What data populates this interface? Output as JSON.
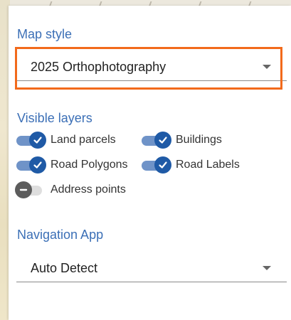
{
  "map_style": {
    "title": "Map style",
    "selected": "2025 Orthophotography"
  },
  "visible_layers": {
    "title": "Visible layers",
    "items": [
      {
        "label": "Land parcels",
        "checked": true
      },
      {
        "label": "Buildings",
        "checked": true
      },
      {
        "label": "Road Polygons",
        "checked": true
      },
      {
        "label": "Road Labels",
        "checked": true
      },
      {
        "label": "Address points",
        "checked": false
      }
    ]
  },
  "navigation_app": {
    "title": "Navigation App",
    "selected": "Auto Detect"
  },
  "colors": {
    "accent": "#1f5aa6",
    "section_title": "#3b6fb6",
    "highlight": "#f26a1b"
  }
}
